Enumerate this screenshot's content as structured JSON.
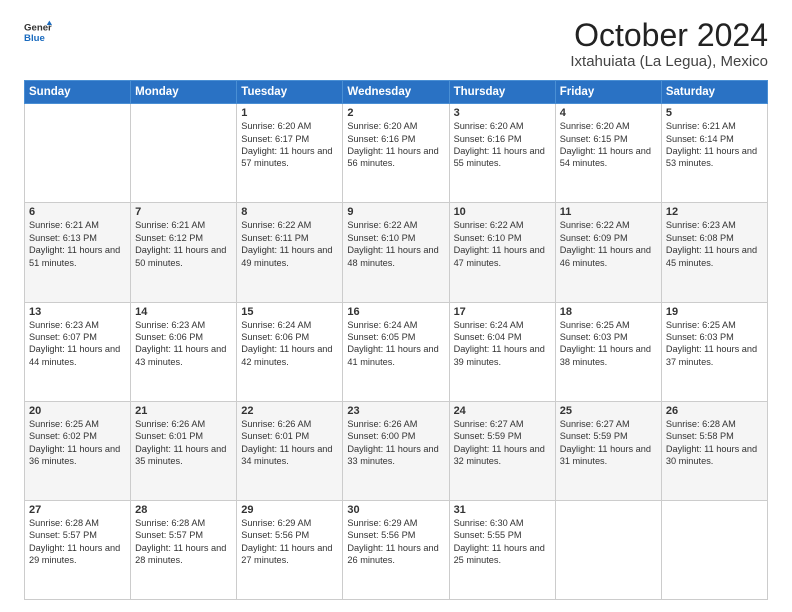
{
  "logo": {
    "general": "General",
    "blue": "Blue"
  },
  "title": "October 2024",
  "subtitle": "Ixtahuiata (La Legua), Mexico",
  "weekdays": [
    "Sunday",
    "Monday",
    "Tuesday",
    "Wednesday",
    "Thursday",
    "Friday",
    "Saturday"
  ],
  "weeks": [
    [
      {
        "day": "",
        "content": ""
      },
      {
        "day": "",
        "content": ""
      },
      {
        "day": "1",
        "content": "Sunrise: 6:20 AM\nSunset: 6:17 PM\nDaylight: 11 hours and 57 minutes."
      },
      {
        "day": "2",
        "content": "Sunrise: 6:20 AM\nSunset: 6:16 PM\nDaylight: 11 hours and 56 minutes."
      },
      {
        "day": "3",
        "content": "Sunrise: 6:20 AM\nSunset: 6:16 PM\nDaylight: 11 hours and 55 minutes."
      },
      {
        "day": "4",
        "content": "Sunrise: 6:20 AM\nSunset: 6:15 PM\nDaylight: 11 hours and 54 minutes."
      },
      {
        "day": "5",
        "content": "Sunrise: 6:21 AM\nSunset: 6:14 PM\nDaylight: 11 hours and 53 minutes."
      }
    ],
    [
      {
        "day": "6",
        "content": "Sunrise: 6:21 AM\nSunset: 6:13 PM\nDaylight: 11 hours and 51 minutes."
      },
      {
        "day": "7",
        "content": "Sunrise: 6:21 AM\nSunset: 6:12 PM\nDaylight: 11 hours and 50 minutes."
      },
      {
        "day": "8",
        "content": "Sunrise: 6:22 AM\nSunset: 6:11 PM\nDaylight: 11 hours and 49 minutes."
      },
      {
        "day": "9",
        "content": "Sunrise: 6:22 AM\nSunset: 6:10 PM\nDaylight: 11 hours and 48 minutes."
      },
      {
        "day": "10",
        "content": "Sunrise: 6:22 AM\nSunset: 6:10 PM\nDaylight: 11 hours and 47 minutes."
      },
      {
        "day": "11",
        "content": "Sunrise: 6:22 AM\nSunset: 6:09 PM\nDaylight: 11 hours and 46 minutes."
      },
      {
        "day": "12",
        "content": "Sunrise: 6:23 AM\nSunset: 6:08 PM\nDaylight: 11 hours and 45 minutes."
      }
    ],
    [
      {
        "day": "13",
        "content": "Sunrise: 6:23 AM\nSunset: 6:07 PM\nDaylight: 11 hours and 44 minutes."
      },
      {
        "day": "14",
        "content": "Sunrise: 6:23 AM\nSunset: 6:06 PM\nDaylight: 11 hours and 43 minutes."
      },
      {
        "day": "15",
        "content": "Sunrise: 6:24 AM\nSunset: 6:06 PM\nDaylight: 11 hours and 42 minutes."
      },
      {
        "day": "16",
        "content": "Sunrise: 6:24 AM\nSunset: 6:05 PM\nDaylight: 11 hours and 41 minutes."
      },
      {
        "day": "17",
        "content": "Sunrise: 6:24 AM\nSunset: 6:04 PM\nDaylight: 11 hours and 39 minutes."
      },
      {
        "day": "18",
        "content": "Sunrise: 6:25 AM\nSunset: 6:03 PM\nDaylight: 11 hours and 38 minutes."
      },
      {
        "day": "19",
        "content": "Sunrise: 6:25 AM\nSunset: 6:03 PM\nDaylight: 11 hours and 37 minutes."
      }
    ],
    [
      {
        "day": "20",
        "content": "Sunrise: 6:25 AM\nSunset: 6:02 PM\nDaylight: 11 hours and 36 minutes."
      },
      {
        "day": "21",
        "content": "Sunrise: 6:26 AM\nSunset: 6:01 PM\nDaylight: 11 hours and 35 minutes."
      },
      {
        "day": "22",
        "content": "Sunrise: 6:26 AM\nSunset: 6:01 PM\nDaylight: 11 hours and 34 minutes."
      },
      {
        "day": "23",
        "content": "Sunrise: 6:26 AM\nSunset: 6:00 PM\nDaylight: 11 hours and 33 minutes."
      },
      {
        "day": "24",
        "content": "Sunrise: 6:27 AM\nSunset: 5:59 PM\nDaylight: 11 hours and 32 minutes."
      },
      {
        "day": "25",
        "content": "Sunrise: 6:27 AM\nSunset: 5:59 PM\nDaylight: 11 hours and 31 minutes."
      },
      {
        "day": "26",
        "content": "Sunrise: 6:28 AM\nSunset: 5:58 PM\nDaylight: 11 hours and 30 minutes."
      }
    ],
    [
      {
        "day": "27",
        "content": "Sunrise: 6:28 AM\nSunset: 5:57 PM\nDaylight: 11 hours and 29 minutes."
      },
      {
        "day": "28",
        "content": "Sunrise: 6:28 AM\nSunset: 5:57 PM\nDaylight: 11 hours and 28 minutes."
      },
      {
        "day": "29",
        "content": "Sunrise: 6:29 AM\nSunset: 5:56 PM\nDaylight: 11 hours and 27 minutes."
      },
      {
        "day": "30",
        "content": "Sunrise: 6:29 AM\nSunset: 5:56 PM\nDaylight: 11 hours and 26 minutes."
      },
      {
        "day": "31",
        "content": "Sunrise: 6:30 AM\nSunset: 5:55 PM\nDaylight: 11 hours and 25 minutes."
      },
      {
        "day": "",
        "content": ""
      },
      {
        "day": "",
        "content": ""
      }
    ]
  ]
}
